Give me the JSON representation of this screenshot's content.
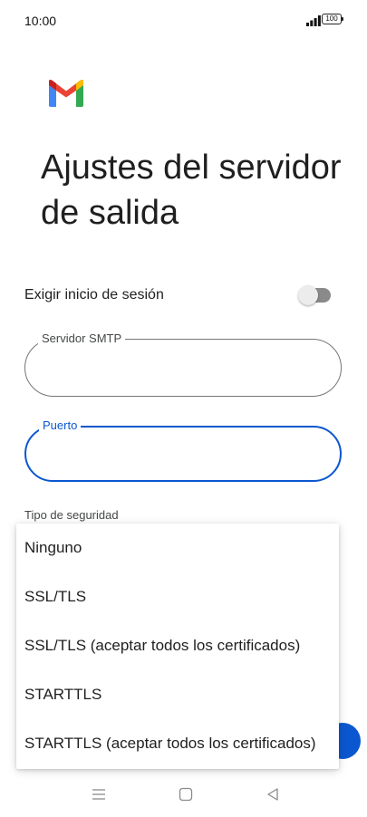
{
  "status_bar": {
    "time": "10:00",
    "battery": "100",
    "icons": [
      "signal-icon",
      "battery-icon"
    ]
  },
  "header": {
    "logo": "gmail-logo",
    "title": "Ajustes del servidor de salida"
  },
  "form": {
    "require_signin": {
      "label": "Exigir inicio de sesión",
      "enabled": false
    },
    "smtp_server": {
      "label": "Servidor SMTP",
      "value": ""
    },
    "port": {
      "label": "Puerto",
      "value": "",
      "focused": true
    },
    "security_type": {
      "label": "Tipo de seguridad"
    }
  },
  "dropdown": {
    "options": [
      "Ninguno",
      "SSL/TLS",
      "SSL/TLS (aceptar todos los certificados)",
      "STARTTLS",
      "STARTTLS (aceptar todos los certificados)"
    ]
  },
  "nav_bar": {
    "icons": [
      "menu-icon",
      "home-icon",
      "back-icon"
    ]
  },
  "colors": {
    "accent": "#0b57d0",
    "toggle_track": "#8a8a8a",
    "outline": "#747775",
    "gmail_red": "#ea4335",
    "gmail_blue": "#4285f4",
    "gmail_green": "#34a853",
    "gmail_yellow": "#fbbc04"
  }
}
